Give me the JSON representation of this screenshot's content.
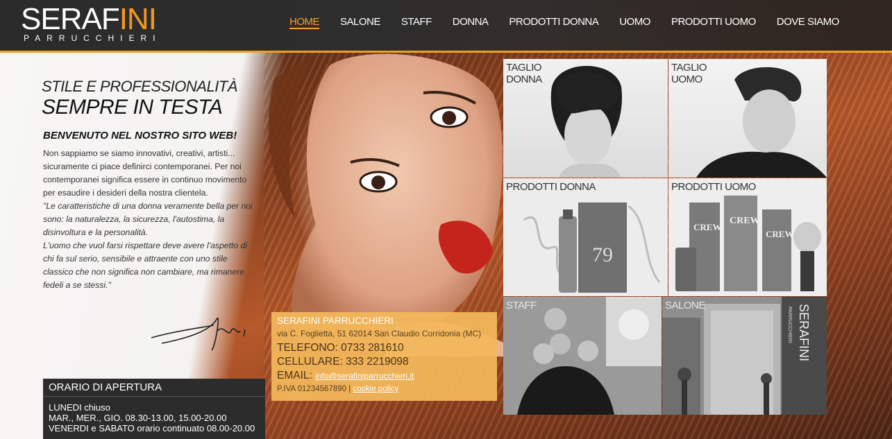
{
  "header": {
    "logo_name_pre": "SERAF",
    "logo_name_ini": "INI",
    "logo_sub": "PARRUCCHIERI",
    "nav": [
      {
        "label": "HOME",
        "active": true
      },
      {
        "label": "SALONE"
      },
      {
        "label": "STAFF"
      },
      {
        "label": "DONNA"
      },
      {
        "label": "PRODOTTI DONNA"
      },
      {
        "label": "UOMO"
      },
      {
        "label": "PRODOTTI UOMO"
      },
      {
        "label": "DOVE SIAMO"
      }
    ]
  },
  "intro": {
    "headline1": "STILE E PROFESSIONALITÀ",
    "headline2": "SEMPRE IN TESTA",
    "welcome": "BENVENUTO NEL NOSTRO SITO WEB!",
    "paragraph": "Non sappiamo se siamo innovativi, creativi, artisti... sicuramente ci piace definirci contemporanei. Per noi contemporanei significa essere in continuo movimento per esaudire i desideri della nostra clientela.",
    "quote1": "\"Le caratteristiche di una donna veramente bella per noi sono: la naturalezza, la sicurezza, l'autostima, la disinvoltura e la personalità.",
    "quote2": "L'uomo che vuol farsi rispettare deve avere l'aspetto di chi fa sul serio, sensibile e attraente con uno stile classico che non significa non cambiare, ma rimanere fedeli a se stessi.\""
  },
  "hours": {
    "title": "ORARIO DI APERTURA",
    "rows": [
      "LUNEDI chiuso",
      "MAR., MER., GIO. 08.30-13.00, 15.00-20.00",
      "VENERDI e SABATO orario continuato 08.00-20.00"
    ]
  },
  "contact": {
    "name": "SERAFINI PARRUCCHIERI",
    "address": "via C. Foglietta, 51 62014 San Claudio Corridonia (MC)",
    "phone": "TELEFONO: 0733 281610",
    "cell": "CELLULARE: 333 2219098",
    "email_label": "EMAIL:",
    "email": "info@serafiniparrucchieri.it",
    "piva": "P.IVA 01234567890 |",
    "cookie": "cookie policy"
  },
  "tiles": {
    "taglio_donna": "TAGLIO\nDONNA",
    "taglio_uomo": "TAGLIO\nUOMO",
    "prodotti_donna": "PRODOTTI DONNA",
    "prodotti_uomo": "PRODOTTI UOMO",
    "staff": "STAFF",
    "salone": "SALONE"
  },
  "product_text": {
    "crew": "CREW",
    "elixir": "79",
    "sign_brand": "SERAFINI",
    "sign_sub": "PARRUCCHIERI"
  },
  "colors": {
    "accent": "#f39a1e",
    "header_bg": "#2b2b2b",
    "contact_bg": "#f3b85a"
  }
}
